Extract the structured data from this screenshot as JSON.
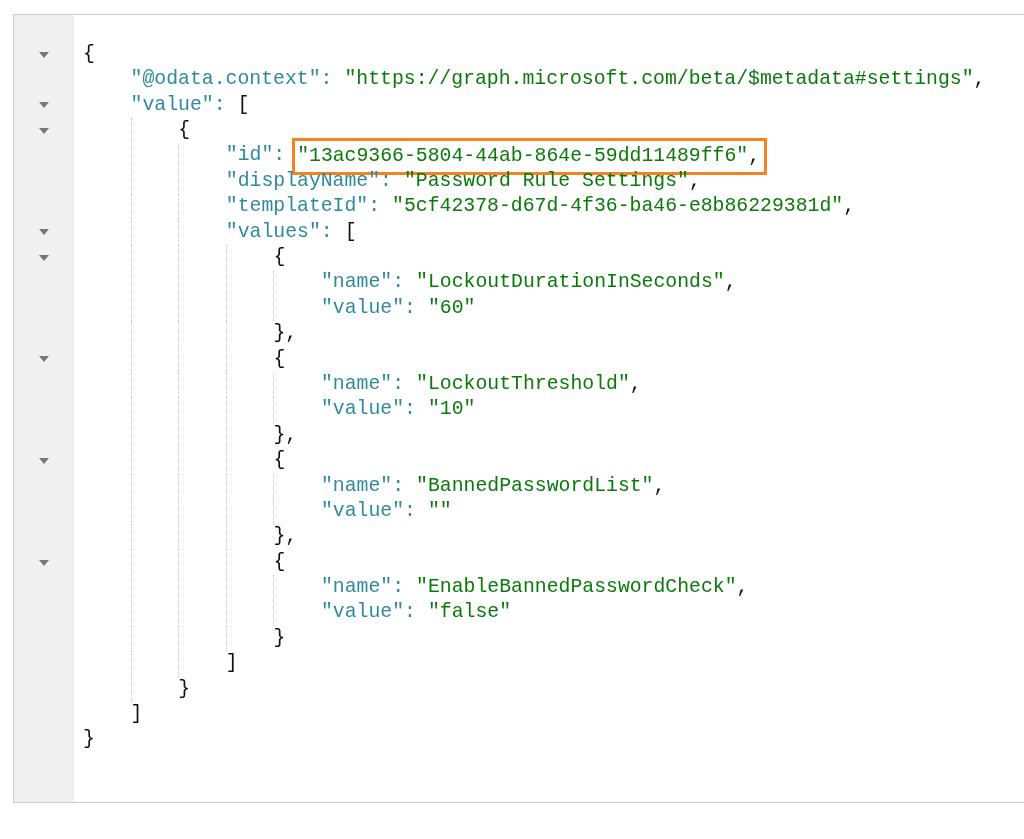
{
  "lines": [
    {
      "open": "{",
      "foldable": true,
      "close": "}",
      "children": [
        {
          "key": "\"@odata.context\":",
          "value": "\"https://graph.microsoft.com/beta/$metadata#settings\","
        },
        {
          "key": "\"value\":",
          "open": "[",
          "foldable": true,
          "close": "]",
          "children": [
            {
              "open": "{",
              "foldable": true,
              "close": "}",
              "children": [
                {
                  "key": "\"id\":",
                  "value": "\"13ac9366-5804-44ab-864e-59dd11489ff6\",",
                  "highlighted": true
                },
                {
                  "key": "\"displayName\":",
                  "value": "\"Password Rule Settings\","
                },
                {
                  "key": "\"templateId\":",
                  "value": "\"5cf42378-d67d-4f36-ba46-e8b86229381d\","
                },
                {
                  "key": "\"values\":",
                  "open": "[",
                  "foldable": true,
                  "close": "]",
                  "children": [
                    {
                      "open": "{",
                      "foldable": true,
                      "close": "},",
                      "children": [
                        {
                          "key": "\"name\":",
                          "value": "\"LockoutDurationInSeconds\","
                        },
                        {
                          "key": "\"value\":",
                          "value": "\"60\""
                        }
                      ]
                    },
                    {
                      "open": "{",
                      "foldable": true,
                      "close": "},",
                      "children": [
                        {
                          "key": "\"name\":",
                          "value": "\"LockoutThreshold\","
                        },
                        {
                          "key": "\"value\":",
                          "value": "\"10\""
                        }
                      ]
                    },
                    {
                      "open": "{",
                      "foldable": true,
                      "close": "},",
                      "children": [
                        {
                          "key": "\"name\":",
                          "value": "\"BannedPasswordList\","
                        },
                        {
                          "key": "\"value\":",
                          "value": "\"\""
                        }
                      ]
                    },
                    {
                      "open": "{",
                      "foldable": true,
                      "close": "}",
                      "children": [
                        {
                          "key": "\"name\":",
                          "value": "\"EnableBannedPasswordCheck\","
                        },
                        {
                          "key": "\"value\":",
                          "value": "\"false\""
                        }
                      ]
                    }
                  ]
                }
              ]
            }
          ]
        }
      ]
    }
  ]
}
